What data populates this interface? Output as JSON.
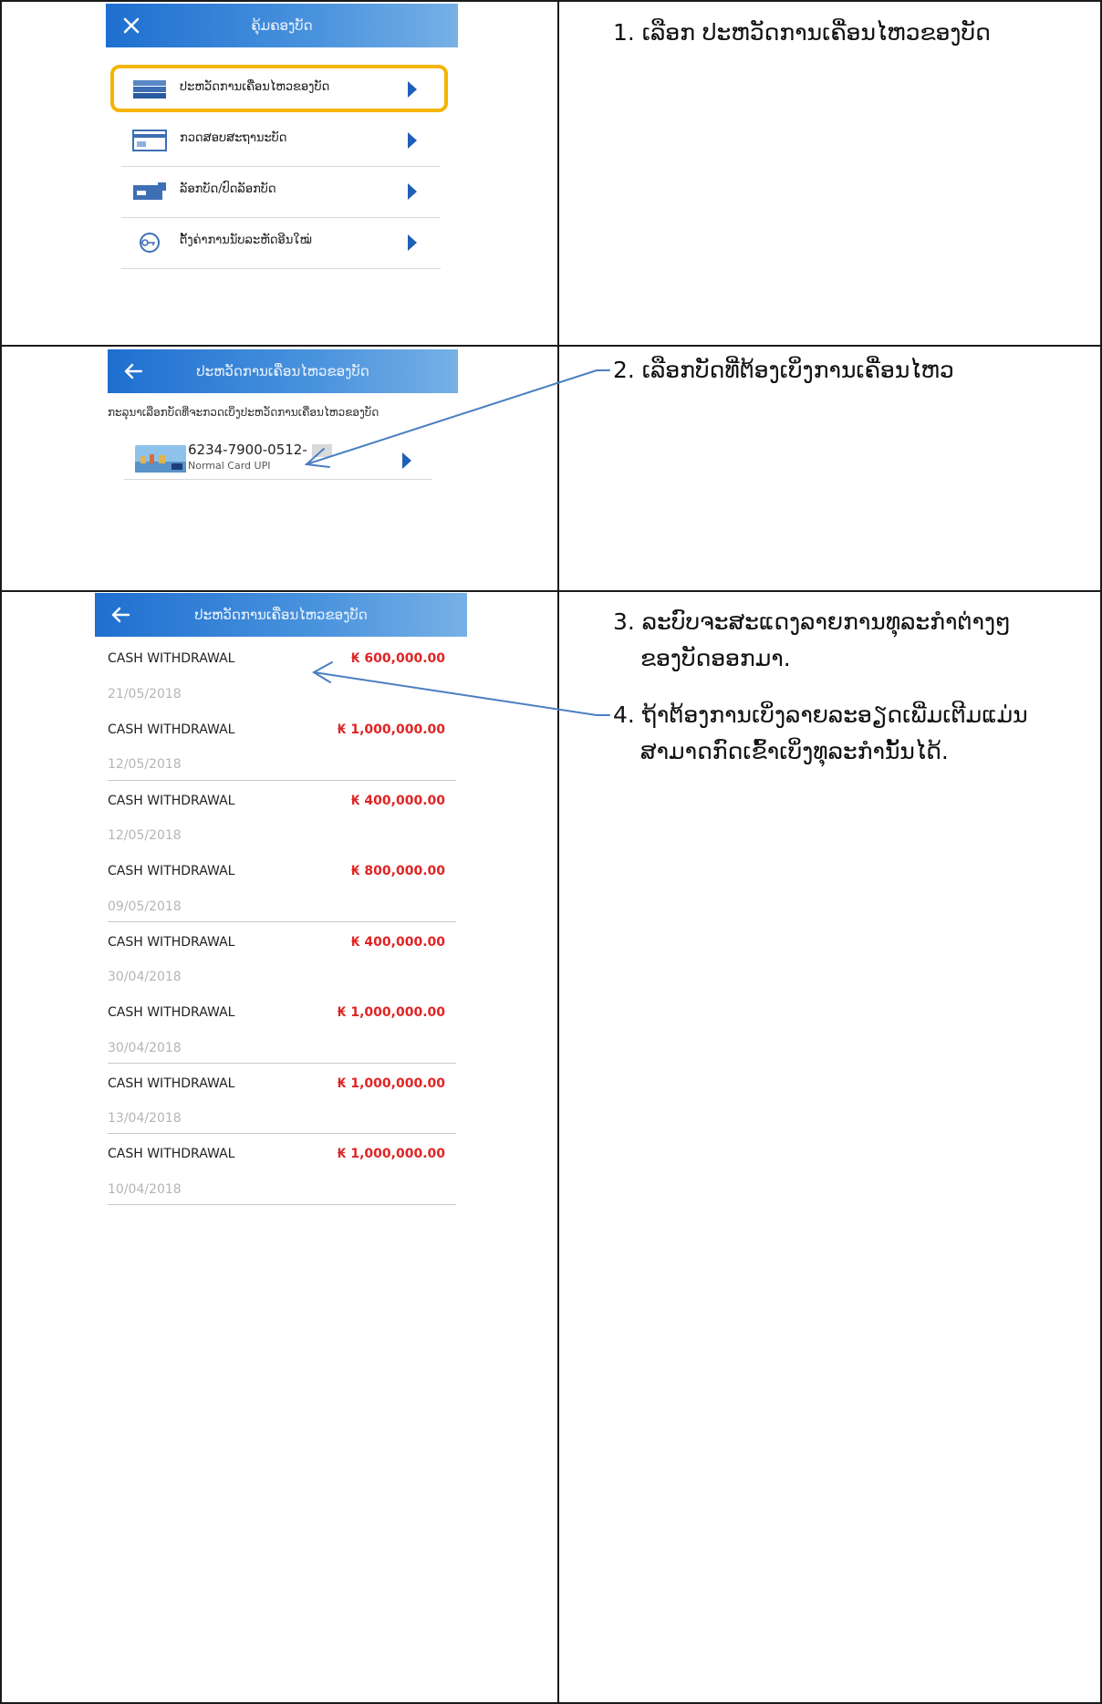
{
  "panel1": {
    "header_title": "ຄຸ້ມຄອງບັດ",
    "menu": [
      {
        "label": "ປະຫວັດການເຄື່ອນໄຫວຂອງບັດ",
        "icon": "card-stack-icon"
      },
      {
        "label": "ກວດສອບສະຖານະບັດ",
        "icon": "card-status-icon"
      },
      {
        "label": "ລັອກບັດ/ປົດລັອກບັດ",
        "icon": "card-lock-icon"
      },
      {
        "label": "ຕັ້ງຄ່າການນັບລະຫັດອີນໃໝ່",
        "icon": "key-reset-icon"
      }
    ],
    "instruction": "1.  ເລືອກ ປະຫວັດການເຄື່ອນໄຫວຂອງບັດ"
  },
  "panel2": {
    "header_title": "ປະຫວັດການເຄື່ອນໄຫວຂອງບັດ",
    "prompt": "ກະລຸນາເລືອກບັດທີ່ຈະກວດເບິ່ງປະຫວັດການເຄື່ອນໄຫວຂອງບັດ",
    "card_number": "6234-7900-0512-",
    "card_type": "Normal Card UPI",
    "instruction": "2.  ເລືອກບັດທີ່ຕ້ອງເບິ່ງການເຄື່ອນໄຫວ"
  },
  "panel3": {
    "header_title": "ປະຫວັດການເຄື່ອນໄຫວຂອງບັດ",
    "transactions": [
      {
        "desc": "CASH WITHDRAWAL",
        "amount": "₭ 600,000.00",
        "date": "21/05/2018"
      },
      {
        "desc": "CASH WITHDRAWAL",
        "amount": "₭ 1,000,000.00",
        "date": "12/05/2018"
      },
      {
        "desc": "CASH WITHDRAWAL",
        "amount": "₭ 400,000.00",
        "date": "12/05/2018"
      },
      {
        "desc": "CASH WITHDRAWAL",
        "amount": "₭ 800,000.00",
        "date": "09/05/2018"
      },
      {
        "desc": "CASH WITHDRAWAL",
        "amount": "₭ 400,000.00",
        "date": "30/04/2018"
      },
      {
        "desc": "CASH WITHDRAWAL",
        "amount": "₭ 1,000,000.00",
        "date": "30/04/2018"
      },
      {
        "desc": "CASH WITHDRAWAL",
        "amount": "₭ 1,000,000.00",
        "date": "13/04/2018"
      },
      {
        "desc": "CASH WITHDRAWAL",
        "amount": "₭ 1,000,000.00",
        "date": "10/04/2018"
      }
    ],
    "instruction_3a": "3.  ລະບົບຈະສະແດງລາຍການທຸລະກຳຕ່າງໆ",
    "instruction_3b": "ຂອງບັດອອກມາ.",
    "instruction_4a": "4.  ຖ້າຕ້ອງການເບິ່ງລາຍລະອຽດເພີ່ມເຕີມແມ່ນ",
    "instruction_4b": "ສາມາດກົດເຂົ້າເບິ່ງທຸລະກຳນັ້ນໄດ້."
  },
  "colors": {
    "accent": "#1f5fb8",
    "highlight": "#f5b400",
    "amount": "#e02424",
    "arrow": "#4a7fc1"
  }
}
